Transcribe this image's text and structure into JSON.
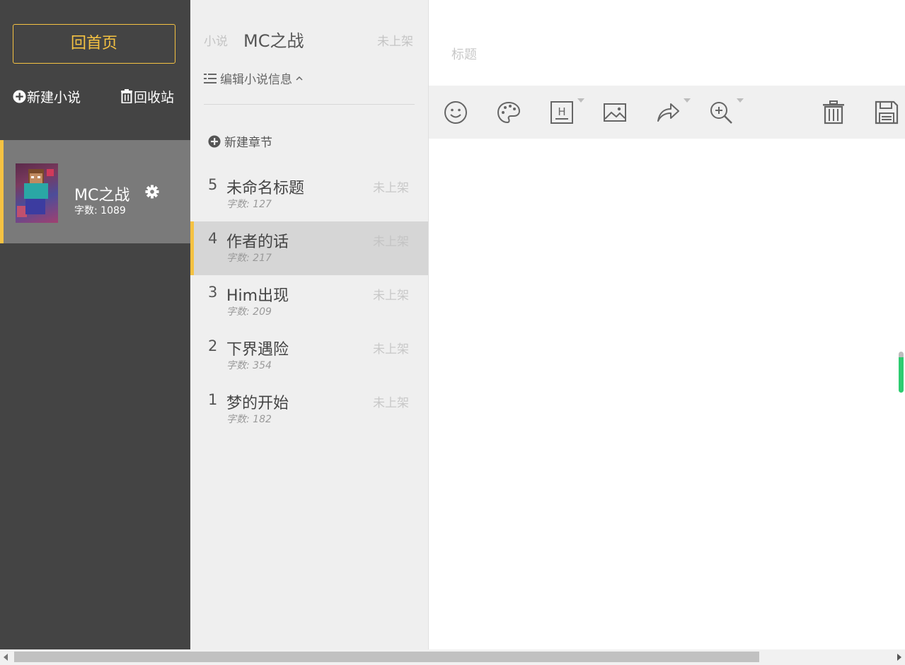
{
  "colors": {
    "accent": "#f5c242",
    "sidebar_bg": "#444444",
    "active_card_bg": "#7a7a7a",
    "panel_bg": "#efefef"
  },
  "sidebar": {
    "home_label": "回首页",
    "new_novel_label": "新建小说",
    "trash_label": "回收站",
    "novel": {
      "title": "MC之战",
      "word_count": "字数: 1089"
    }
  },
  "chapter_panel": {
    "type_label": "小说",
    "novel_title": "MC之战",
    "status": "未上架",
    "edit_info_label": "编辑小说信息",
    "new_chapter_label": "新建章节",
    "chapters": [
      {
        "num": "5",
        "title": "未命名标题",
        "status": "未上架",
        "count": "字数: 127",
        "active": false
      },
      {
        "num": "4",
        "title": "作者的话",
        "status": "未上架",
        "count": "字数: 217",
        "active": true
      },
      {
        "num": "3",
        "title": "Him出现",
        "status": "未上架",
        "count": "字数: 209",
        "active": false
      },
      {
        "num": "2",
        "title": "下界遇险",
        "status": "未上架",
        "count": "字数: 354",
        "active": false
      },
      {
        "num": "1",
        "title": "梦的开始",
        "status": "未上架",
        "count": "字数: 182",
        "active": false
      }
    ]
  },
  "editor": {
    "title_placeholder": "标题",
    "title_value": "",
    "toolbar": [
      "emoji-icon",
      "palette-icon",
      "heading-icon",
      "image-icon",
      "share-icon",
      "zoom-icon",
      "trash-icon",
      "save-icon"
    ]
  }
}
